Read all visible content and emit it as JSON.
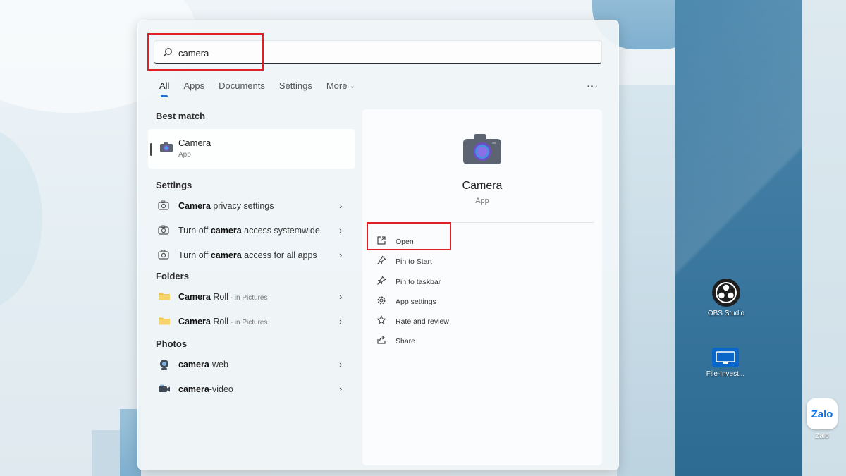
{
  "search": {
    "value": "camera",
    "placeholder": ""
  },
  "tabs": [
    {
      "label": "All",
      "active": true
    },
    {
      "label": "Apps"
    },
    {
      "label": "Documents"
    },
    {
      "label": "Settings"
    },
    {
      "label": "More"
    }
  ],
  "sections": {
    "best_match": "Best match",
    "settings": "Settings",
    "folders": "Folders",
    "photos": "Photos"
  },
  "best_match": {
    "title_bold": "Camera",
    "title_rest": "",
    "subtitle": "App"
  },
  "settings_items": [
    {
      "bold": "Camera",
      "pre": "",
      "post": " privacy settings",
      "icon": "camera-outline-icon"
    },
    {
      "bold": "camera",
      "pre": "Turn off ",
      "post": " access systemwide",
      "icon": "camera-outline-icon"
    },
    {
      "bold": "camera",
      "pre": "Turn off ",
      "post": " access for all apps",
      "icon": "camera-outline-icon"
    }
  ],
  "folder_items": [
    {
      "bold": "Camera",
      "post": " Roll",
      "sub": " - in Pictures",
      "icon": "folder-icon"
    },
    {
      "bold": "Camera",
      "post": " Roll",
      "sub": " - in Pictures",
      "icon": "folder-icon"
    }
  ],
  "photo_items": [
    {
      "bold": "camera",
      "post": "-web",
      "icon": "webcam-icon"
    },
    {
      "bold": "camera",
      "post": "-video",
      "icon": "video-camera-icon"
    }
  ],
  "detail": {
    "name": "Camera",
    "type": "App",
    "actions": [
      {
        "label": "Open",
        "icon": "open-external-icon"
      },
      {
        "label": "Pin to Start",
        "icon": "pin-icon"
      },
      {
        "label": "Pin to taskbar",
        "icon": "pin-icon"
      },
      {
        "label": "App settings",
        "icon": "gear-icon"
      },
      {
        "label": "Rate and review",
        "icon": "star-icon"
      },
      {
        "label": "Share",
        "icon": "share-icon"
      }
    ]
  },
  "desktop_icons": [
    {
      "label": "OBS Studio",
      "icon": "obs-studio-icon"
    },
    {
      "label": "File-Invest...",
      "icon": "monitor-icon"
    },
    {
      "label": "Zalo",
      "icon": "zalo-icon",
      "badge": "Zalo"
    }
  ],
  "colors": {
    "accent": "#1f6fcf",
    "highlight": "#e01f26"
  }
}
